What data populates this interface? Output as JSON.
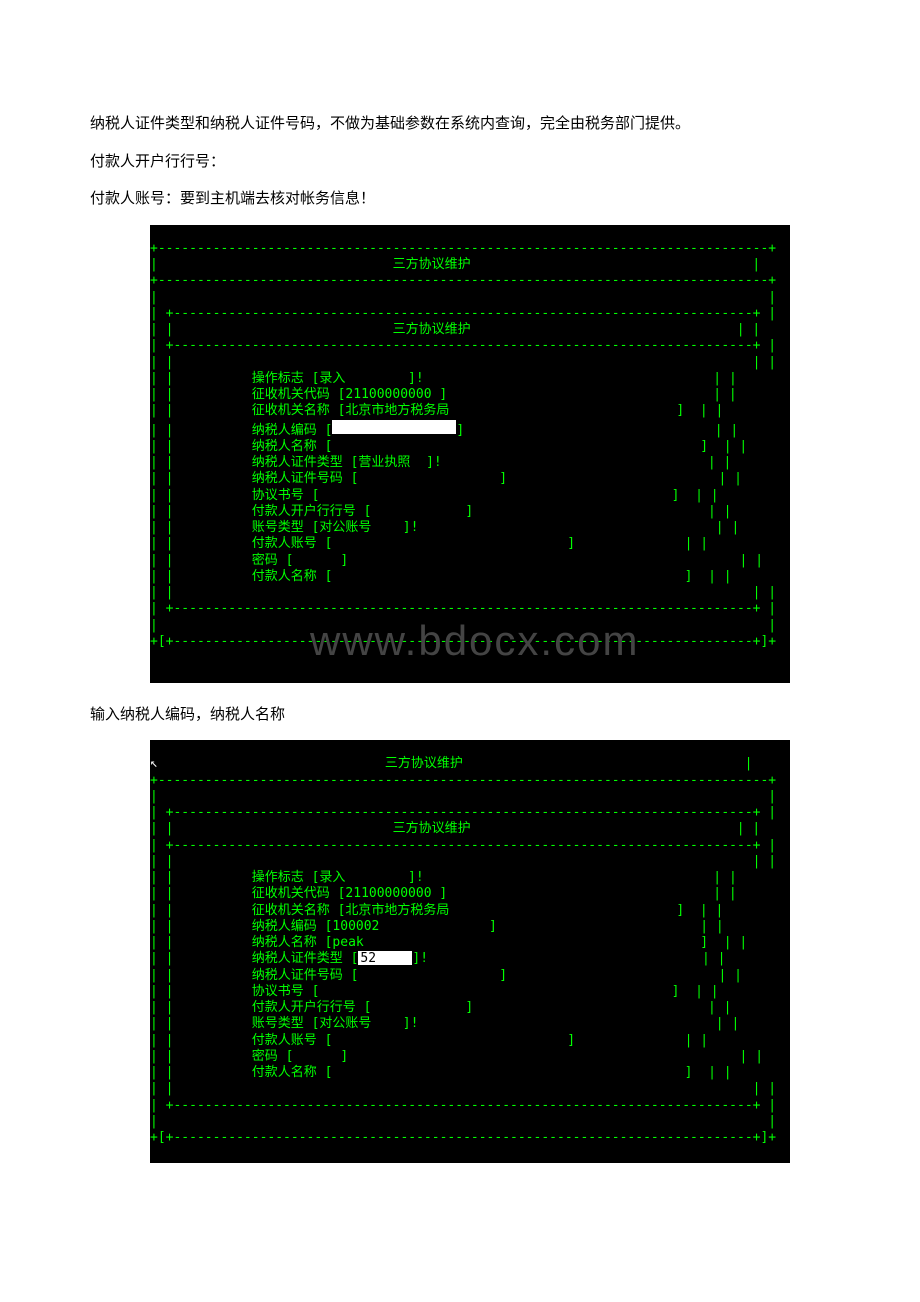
{
  "doc": {
    "para1": "纳税人证件类型和纳税人证件号码，不做为基础参数在系统内查询，完全由税务部门提供。",
    "para2": "付款人开户行行号：",
    "para3": "付款人账号：要到主机端去核对帐务信息！",
    "para4": "输入纳税人编码，纳税人名称"
  },
  "term1": {
    "titleOuter": "三方协议维护",
    "titleInner": "三方协议维护",
    "fields": {
      "op_label": "操作标志",
      "op_val": "录入",
      "code_label": "征收机关代码",
      "code_val": "21100000000",
      "name_label": "征收机关名称",
      "name_val": "北京市地方税务局",
      "tax_code_label": "纳税人编码",
      "tax_name_label": "纳税人名称",
      "cert_type_label": "纳税人证件类型",
      "cert_type_val": "营业执照",
      "cert_no_label": "纳税人证件号码",
      "agr_no_label": "协议书号",
      "payer_bank_label": "付款人开户行行号",
      "acct_type_label": "账号类型",
      "acct_type_val": "对公账号",
      "payer_acct_label": "付款人账号",
      "pwd_label": "密码",
      "payer_name_label": "付款人名称"
    },
    "watermark": "www.bdocx.com"
  },
  "term2": {
    "titleOuter": "三方协议维护",
    "titleInner": "三方协议维护",
    "fields": {
      "op_label": "操作标志",
      "op_val": "录入",
      "code_label": "征收机关代码",
      "code_val": "21100000000",
      "name_label": "征收机关名称",
      "name_val": "北京市地方税务局",
      "tax_code_label": "纳税人编码",
      "tax_code_val": "100002",
      "tax_name_label": "纳税人名称",
      "tax_name_val": "peak",
      "cert_type_label": "纳税人证件类型",
      "cert_type_val": "52",
      "cert_no_label": "纳税人证件号码",
      "agr_no_label": "协议书号",
      "payer_bank_label": "付款人开户行行号",
      "acct_type_label": "账号类型",
      "acct_type_val": "对公账号",
      "payer_acct_label": "付款人账号",
      "pwd_label": "密码",
      "payer_name_label": "付款人名称"
    }
  }
}
